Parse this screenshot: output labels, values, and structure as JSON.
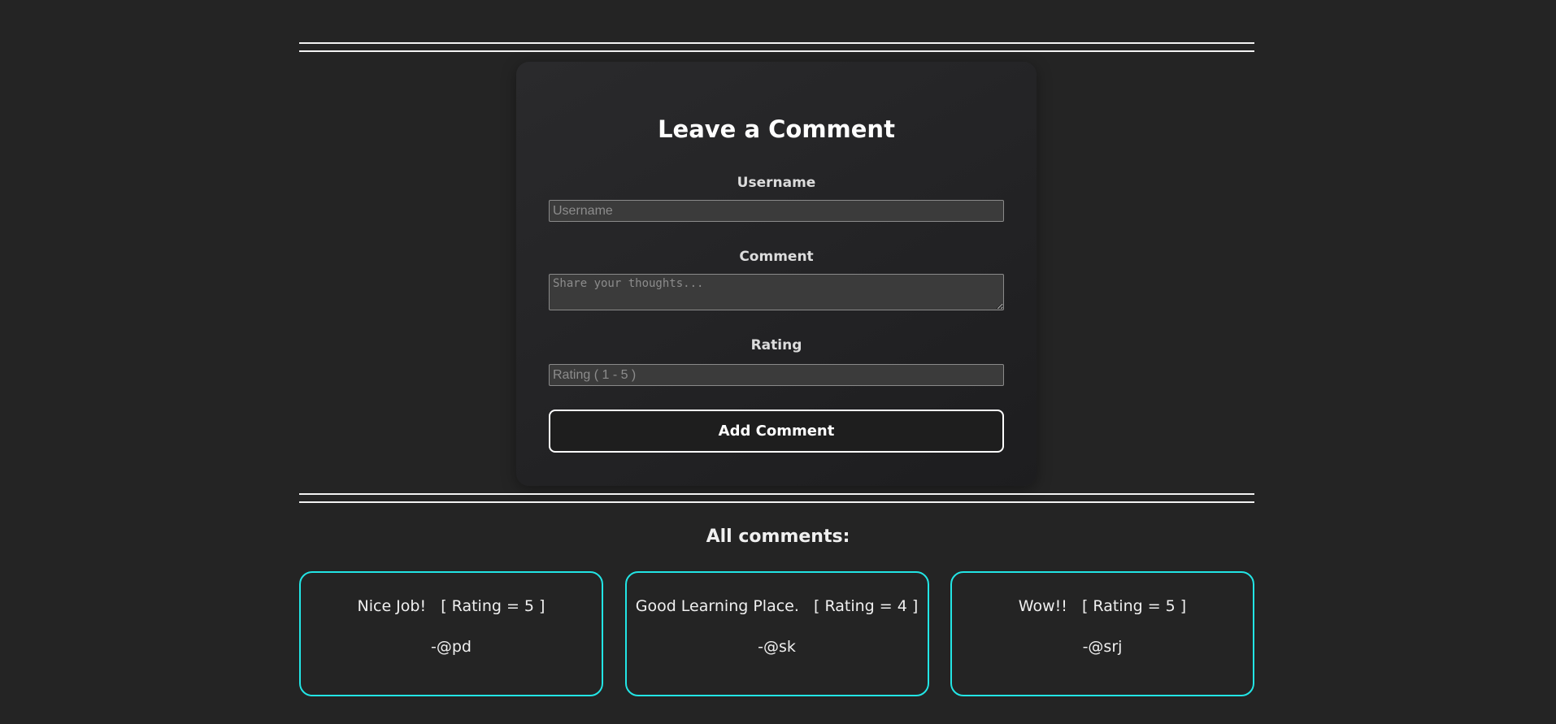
{
  "form": {
    "title": "Leave a Comment",
    "username_label": "Username",
    "username_placeholder": "Username",
    "username_value": "",
    "comment_label": "Comment",
    "comment_placeholder": "Share your thoughts...",
    "comment_value": "",
    "rating_label": "Rating",
    "rating_placeholder": "Rating ( 1 - 5 )",
    "rating_value": "",
    "submit_label": "Add Comment"
  },
  "comments_section": {
    "title": "All comments:",
    "comments": [
      {
        "text": "Nice Job!   [ Rating = 5 ]",
        "author": "-@pd"
      },
      {
        "text": "Good Learning Place.   [ Rating = 4 ]",
        "author": "-@sk"
      },
      {
        "text": "Wow!!   [ Rating = 5 ]",
        "author": "-@srj"
      }
    ]
  },
  "colors": {
    "background": "#242424",
    "card_border_accent": "#22e5e5",
    "text": "#ffffff"
  }
}
